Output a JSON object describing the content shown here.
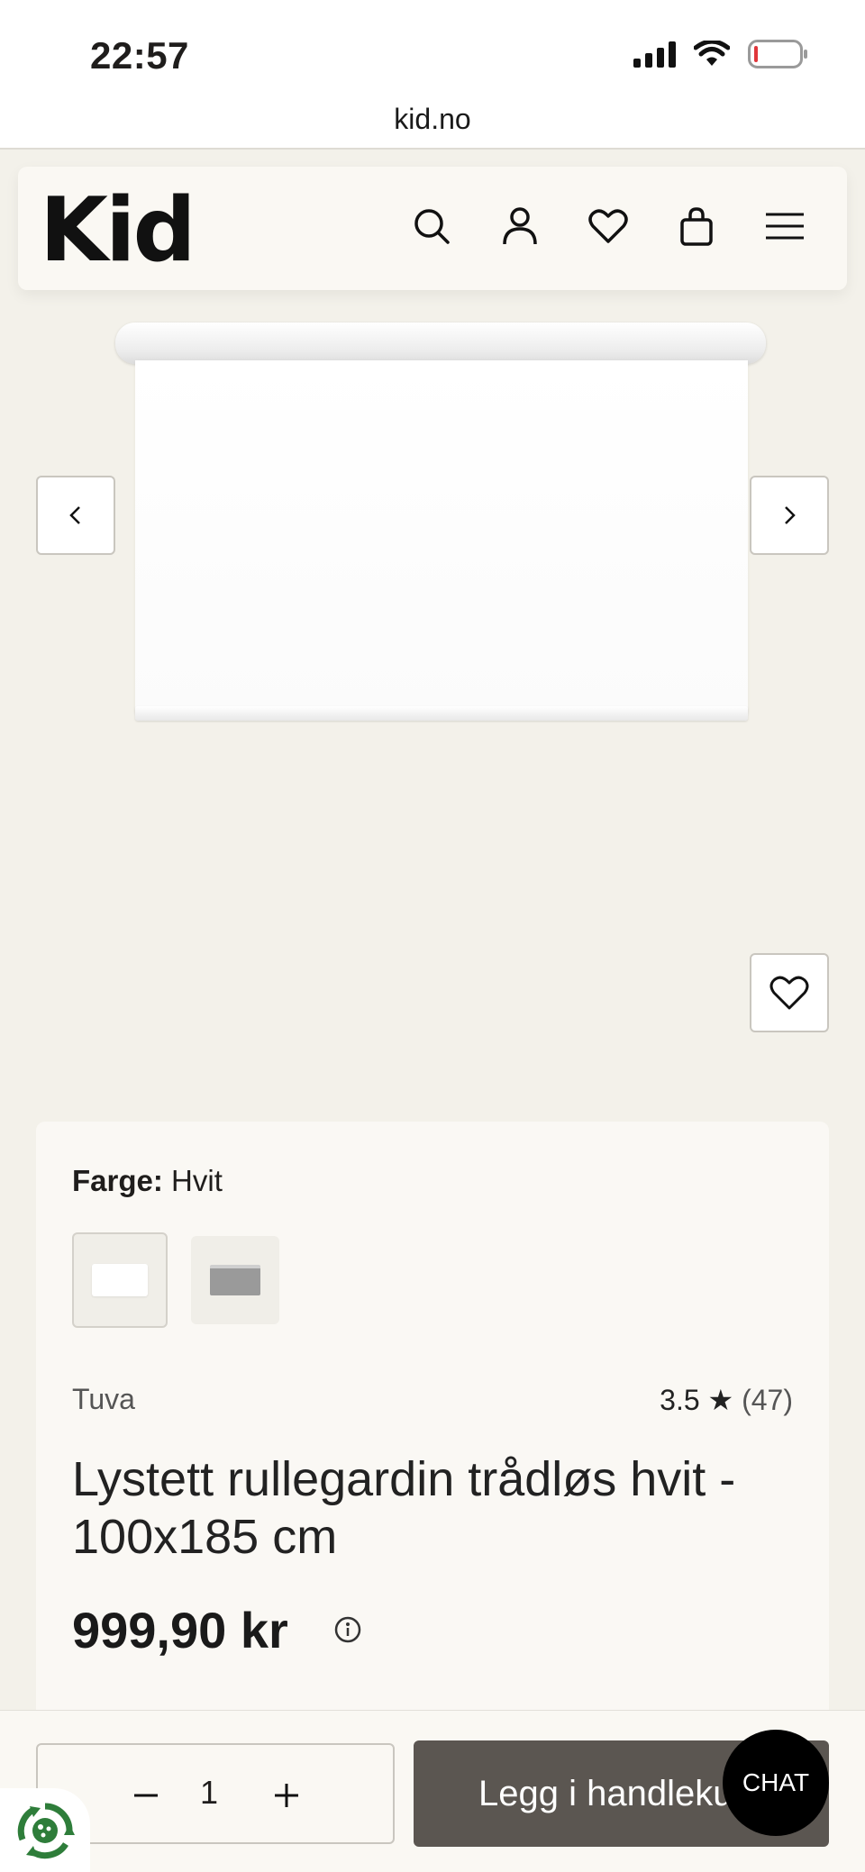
{
  "status_bar": {
    "time": "22:57"
  },
  "browser": {
    "url": "kid.no"
  },
  "header": {
    "logo": "Kid",
    "icons": [
      "search-icon",
      "account-icon",
      "wishlist-icon",
      "cart-icon",
      "menu-icon"
    ]
  },
  "gallery": {
    "prev_icon": "chevron-left-icon",
    "next_icon": "chevron-right-icon",
    "favorite_icon": "heart-icon"
  },
  "product": {
    "color_label": "Farge:",
    "color_value": "Hvit",
    "swatches": [
      {
        "name": "Hvit",
        "color": "#ffffff",
        "selected": true
      },
      {
        "name": "Grå",
        "color": "#9a9a9a",
        "selected": false
      }
    ],
    "brand": "Tuva",
    "rating": "3.5",
    "rating_star": "★",
    "review_count": "(47)",
    "title": "Lystett rullegardin trådløs hvit - 100x185 cm",
    "price": "999,90 kr"
  },
  "cart_bar": {
    "quantity": "1",
    "add_button_label": "Legg i handlekurv",
    "chat_label": "CHAT"
  },
  "colors": {
    "page_bg": "#f3f1ea",
    "card_bg": "#faf8f4",
    "add_button_bg": "#5b5651",
    "chat_bg": "#000000",
    "eco_green": "#2e7d3a"
  }
}
